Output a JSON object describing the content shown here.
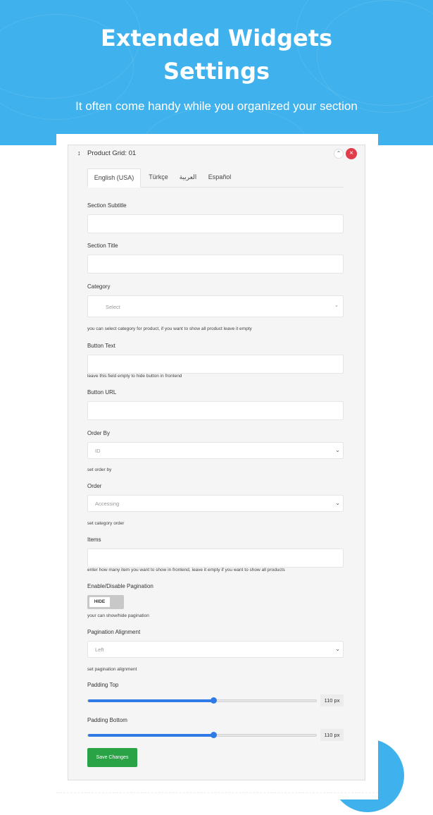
{
  "hero": {
    "title_line1": "Extended Widgets",
    "title_line2": "Settings",
    "subtitle": "It often come handy while you organized your section"
  },
  "panel": {
    "title": "Product Grid: 01",
    "tabs": [
      "English (USA)",
      "Türkçe",
      "العربية",
      "Español"
    ],
    "active_tab": "English (USA)"
  },
  "form": {
    "section_subtitle": {
      "label": "Section Subtitle",
      "value": ""
    },
    "section_title": {
      "label": "Section Title",
      "value": ""
    },
    "category": {
      "label": "Category",
      "selected": "Select",
      "hint": "you can select category for product, if you want to show all product leave it empty"
    },
    "button_text": {
      "label": "Button Text",
      "value": "",
      "hint": "leave this field empty to hide button in frontend"
    },
    "button_url": {
      "label": "Button URL",
      "value": ""
    },
    "order_by": {
      "label": "Order By",
      "selected": "ID",
      "hint": "set order by"
    },
    "order": {
      "label": "Order",
      "selected": "Accessing",
      "hint": "set category order"
    },
    "items": {
      "label": "Items",
      "value": "",
      "hint": "enter how many item you want to show in frontend, leave it empty if you want to show all products"
    },
    "pagination": {
      "label": "Enable/Disable Pagination",
      "state": "HIDE",
      "hint": "your can show/hide pagination"
    },
    "pagination_alignment": {
      "label": "Pagination Alignment",
      "selected": "Left",
      "hint": "set pagination alignment"
    },
    "padding_top": {
      "label": "Padding Top",
      "value": 110,
      "max": 200,
      "display": "110 px"
    },
    "padding_bottom": {
      "label": "Padding Bottom",
      "value": 110,
      "max": 200,
      "display": "110 px"
    },
    "save_label": "Save Changes"
  },
  "colors": {
    "brand_blue": "#3fb1ec",
    "slider_blue": "#2f7ae5",
    "save_green": "#29a346",
    "close_red": "#e23b4a"
  }
}
